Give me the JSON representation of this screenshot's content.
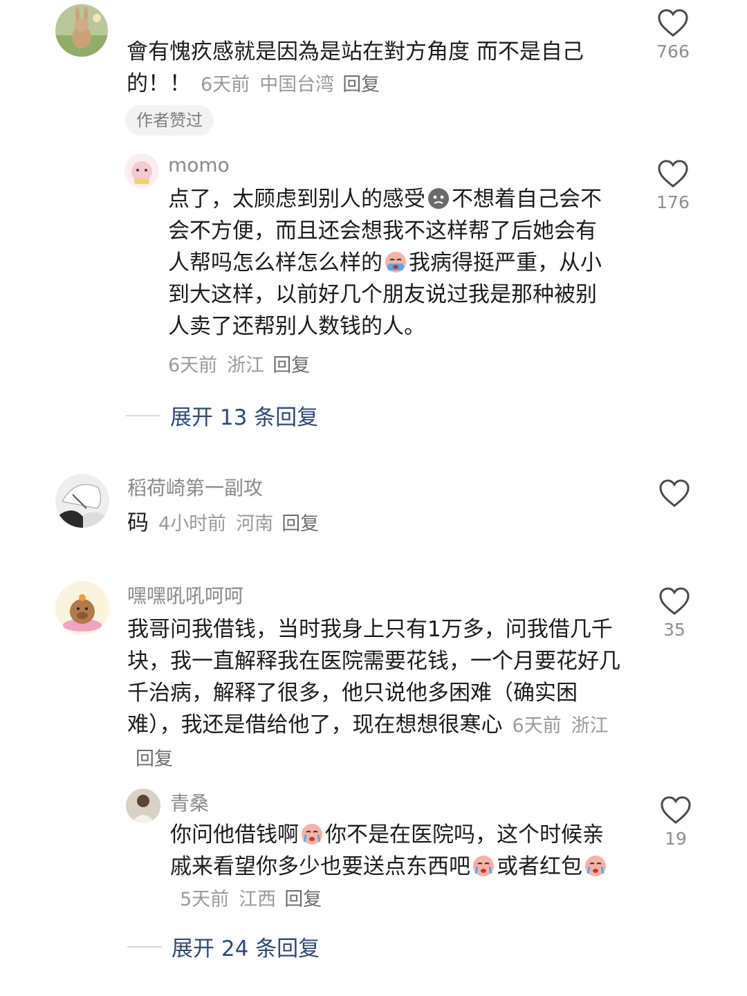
{
  "comments": [
    {
      "author": "",
      "text": "會有愧疚感就是因為是站在對方角度 而不是自己的！！",
      "time": "6天前",
      "location": "中国台湾",
      "reply_label": "回复",
      "badge": "作者赞过",
      "likes": "766",
      "replies": [
        {
          "author": "momo",
          "text_parts": [
            "点了，太顾虑到别人的感受",
            "不想着自己会不会不方便，而且还会想我不这样帮了后她会有人帮吗怎么样怎么样的",
            "我病得挺严重，从小到大这样，以前好几个朋友说过我是那种被别人卖了还帮别人数钱的人。"
          ],
          "emojis": [
            "sad-face-emoji",
            "crying-face-emoji"
          ],
          "time": "6天前",
          "location": "浙江",
          "reply_label": "回复",
          "likes": "176"
        }
      ],
      "expand_label": "展开 13 条回复"
    },
    {
      "author": "稻荷崎第一副攻",
      "text": "码",
      "time": "4小时前",
      "location": "河南",
      "reply_label": "回复",
      "likes": ""
    },
    {
      "author": "嘿嘿吼吼呵呵",
      "text": "我哥问我借钱，当时我身上只有1万多，问我借几千块，我一直解释我在医院需要花钱，一个月要花好几千治病，解释了很多，他只说他多困难（确实困难），我还是借给他了，现在想想很寒心",
      "time": "6天前",
      "location": "浙江",
      "reply_label": "回复",
      "likes": "35",
      "replies": [
        {
          "author": "青桑",
          "text_parts": [
            "你问他借钱啊",
            "你不是在医院吗，这个时候亲戚来看望你多少也要送点东西吧",
            "或者红包"
          ],
          "emojis": [
            "crying-face-emoji",
            "crying-face-emoji",
            "crying-face-emoji"
          ],
          "time": "5天前",
          "location": "江西",
          "reply_label": "回复",
          "likes": "19"
        }
      ],
      "expand_label": "展开 24 条回复"
    }
  ],
  "colors": {
    "expand_text": "#2c4a78",
    "meta": "#9a9a9a",
    "heart_stroke": "#4a4a4a"
  }
}
